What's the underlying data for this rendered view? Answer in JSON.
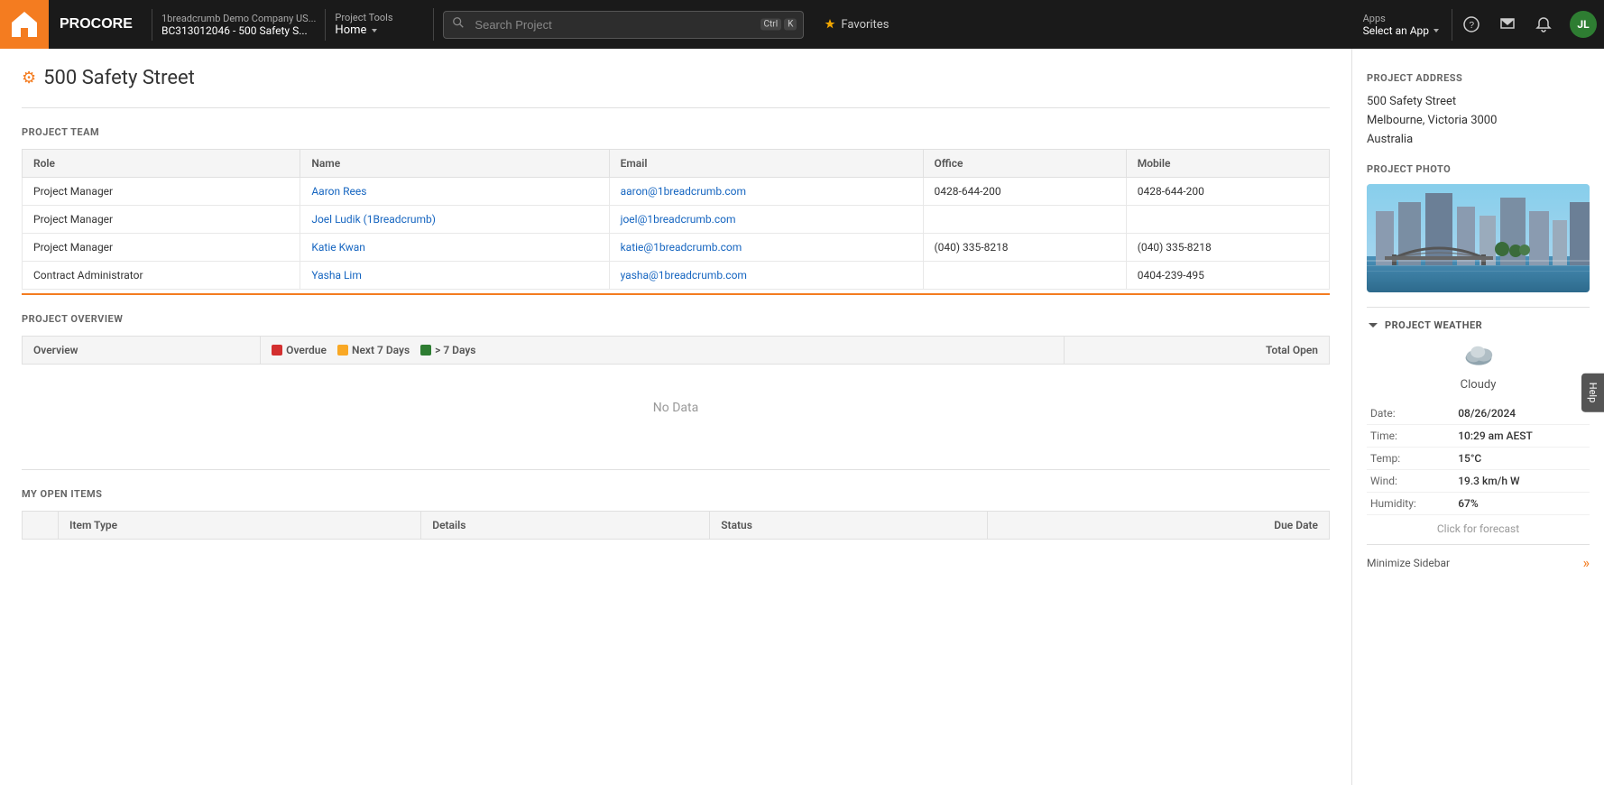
{
  "topbar": {
    "logo_text": "PROCORE",
    "breadcrumb_top": "1breadcrumb Demo Company US...",
    "breadcrumb_bottom": "BC313012046 - 500 Safety S...",
    "project_tools_top": "Project Tools",
    "project_tools_bottom": "Home",
    "search_placeholder": "Search Project",
    "search_shortcut_1": "Ctrl",
    "search_shortcut_2": "K",
    "favorites_label": "Favorites",
    "apps_top": "Apps",
    "apps_bottom": "Select an App",
    "avatar_initials": "JL"
  },
  "project": {
    "title": "500 Safety Street"
  },
  "project_team": {
    "section_title": "PROJECT TEAM",
    "columns": [
      "Role",
      "Name",
      "Email",
      "Office",
      "Mobile"
    ],
    "rows": [
      {
        "role": "Project Manager",
        "name": "Aaron Rees",
        "email": "aaron@1breadcrumb.com",
        "office": "0428-644-200",
        "mobile": "0428-644-200"
      },
      {
        "role": "Project Manager",
        "name": "Joel Ludik (1Breadcrumb)",
        "email": "joel@1breadcrumb.com",
        "office": "",
        "mobile": ""
      },
      {
        "role": "Project Manager",
        "name": "Katie Kwan",
        "email": "katie@1breadcrumb.com",
        "office": "(040) 335-8218",
        "mobile": "(040) 335-8218"
      },
      {
        "role": "Contract Administrator",
        "name": "Yasha Lim",
        "email": "yasha@1breadcrumb.com",
        "office": "",
        "mobile": "0404-239-495"
      }
    ]
  },
  "project_overview": {
    "section_title": "PROJECT OVERVIEW",
    "overview_col": "Overview",
    "total_open_col": "Total Open",
    "legend": [
      {
        "label": "Overdue",
        "color": "#d32f2f"
      },
      {
        "label": "Next 7 Days",
        "color": "#f9a825"
      },
      {
        "label": "> 7 Days",
        "color": "#2e7d32"
      }
    ],
    "no_data_text": "No Data"
  },
  "my_open_items": {
    "section_title": "MY OPEN ITEMS",
    "columns": [
      "",
      "Item Type",
      "Details",
      "Status",
      "Due Date"
    ],
    "rows": []
  },
  "sidebar": {
    "project_address_title": "PROJECT ADDRESS",
    "address_line1": "500 Safety Street",
    "address_line2": "Melbourne, Victoria 3000",
    "address_line3": "Australia",
    "project_photo_title": "PROJECT PHOTO",
    "weather_title": "PROJECT WEATHER",
    "weather_condition": "Cloudy",
    "weather_fields": [
      {
        "label": "Date:",
        "value": "08/26/2024"
      },
      {
        "label": "Time:",
        "value": "10:29 am AEST"
      },
      {
        "label": "Temp:",
        "value": "15°C"
      },
      {
        "label": "Wind:",
        "value": "19.3 km/h W"
      },
      {
        "label": "Humidity:",
        "value": "67%"
      }
    ],
    "forecast_link": "Click for forecast",
    "minimize_label": "Minimize Sidebar"
  },
  "help_tab": "Help"
}
